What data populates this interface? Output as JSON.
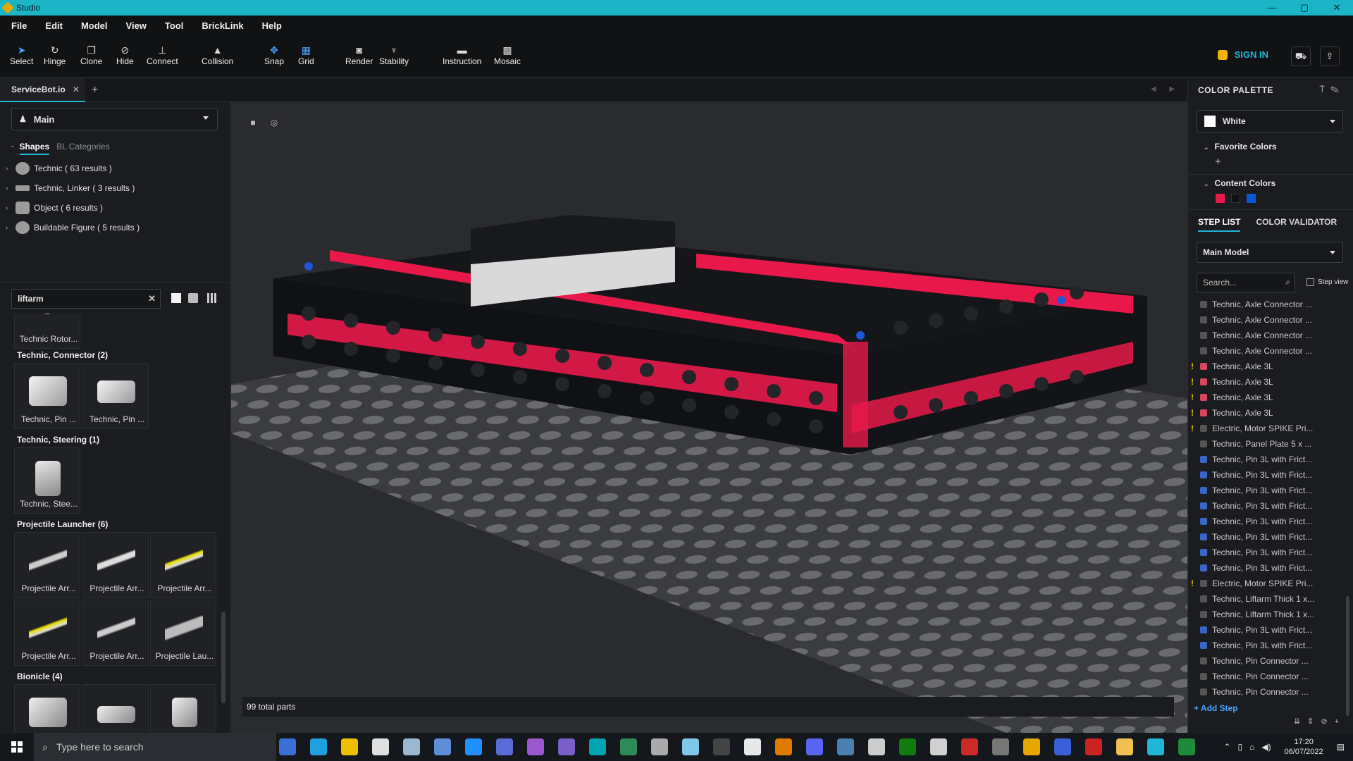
{
  "window": {
    "title": "Studio",
    "controls": [
      "—",
      "▢",
      "✕"
    ]
  },
  "menu": [
    "File",
    "Edit",
    "Model",
    "View",
    "Tool",
    "BrickLink",
    "Help"
  ],
  "toolbar": {
    "tools": [
      {
        "label": "Select",
        "icon": "cursor-icon",
        "glyph": "➤"
      },
      {
        "label": "Hinge",
        "icon": "hinge-icon",
        "glyph": "↻"
      },
      {
        "label": "Clone",
        "icon": "clone-icon",
        "glyph": "❐"
      },
      {
        "label": "Hide",
        "icon": "hide-icon",
        "glyph": "⊘"
      },
      {
        "label": "Connect",
        "icon": "connect-icon",
        "glyph": "⊥"
      },
      {
        "label": "Collision",
        "icon": "collision-icon",
        "glyph": "▲"
      },
      {
        "label": "Snap",
        "icon": "snap-icon",
        "glyph": "✥"
      },
      {
        "label": "Grid",
        "icon": "grid-icon",
        "glyph": "▦"
      },
      {
        "label": "Render",
        "icon": "camera-icon",
        "glyph": "◙"
      },
      {
        "label": "Stability",
        "icon": "stability-icon",
        "glyph": "♆"
      },
      {
        "label": "Instruction",
        "icon": "instruction-icon",
        "glyph": "▬"
      },
      {
        "label": "Mosaic",
        "icon": "mosaic-icon",
        "glyph": "▩"
      }
    ],
    "signin": "SIGN IN"
  },
  "tabs": {
    "active": "ServiceBot.io",
    "close": "✕",
    "add": "+",
    "nav": "◀ ▶"
  },
  "left": {
    "model_dropdown": "Main",
    "subtabs": [
      "Shapes",
      "BL Categories"
    ],
    "shapes": [
      {
        "label": "Technic ( 63 results )"
      },
      {
        "label": "Technic, Linker ( 3 results )"
      },
      {
        "label": "Object ( 6 results )"
      },
      {
        "label": "Buildable Figure ( 5 results )"
      }
    ],
    "search_value": "liftarm",
    "search_clear": "✕",
    "top_partial_label": "Technic Rotor...",
    "categories": [
      {
        "title": "Technic, Connector (2)",
        "parts": [
          "Technic, Pin ...",
          "Technic, Pin ..."
        ]
      },
      {
        "title": "Technic, Steering (1)",
        "parts": [
          "Technic, Stee..."
        ]
      },
      {
        "title": "Projectile Launcher (6)",
        "parts": [
          "Projectile Arr...",
          "Projectile Arr...",
          "Projectile Arr...",
          "Projectile Arr...",
          "Projectile Arr...",
          "Projectile Lau..."
        ]
      },
      {
        "title": "Bionicle (4)",
        "parts": [
          "",
          "",
          ""
        ]
      }
    ]
  },
  "viewport": {
    "total_parts": "99 total parts"
  },
  "right": {
    "color_palette_title": "COLOR PALETTE",
    "selected_color": "White",
    "favorite_colors": "Favorite Colors",
    "add_favorite": "+",
    "content_colors": "Content Colors",
    "content_swatches": [
      "#e8194a",
      "#0f1215",
      "#0a57d4"
    ],
    "step_tabs": [
      "STEP LIST",
      "COLOR VALIDATOR"
    ],
    "model": "Main Model",
    "search_placeholder": "Search...",
    "step_view": "Step view",
    "steps": [
      {
        "t": "Technic, Axle Connector ...",
        "w": false,
        "c": "#555"
      },
      {
        "t": "Technic, Axle Connector ...",
        "w": false,
        "c": "#555"
      },
      {
        "t": "Technic, Axle Connector ...",
        "w": false,
        "c": "#555"
      },
      {
        "t": "Technic, Axle Connector ...",
        "w": false,
        "c": "#555"
      },
      {
        "t": "Technic, Axle  3L",
        "w": true,
        "c": "#d8475f"
      },
      {
        "t": "Technic, Axle  3L",
        "w": true,
        "c": "#d8475f"
      },
      {
        "t": "Technic, Axle  3L",
        "w": true,
        "c": "#d8475f"
      },
      {
        "t": "Technic, Axle  3L",
        "w": true,
        "c": "#d8475f"
      },
      {
        "t": "Electric, Motor SPIKE Pri...",
        "w": true,
        "c": "#555"
      },
      {
        "t": "Technic, Panel Plate 5 x ...",
        "w": false,
        "c": "#555"
      },
      {
        "t": "Technic, Pin 3L with Frict...",
        "w": false,
        "c": "#3a64c8"
      },
      {
        "t": "Technic, Pin 3L with Frict...",
        "w": false,
        "c": "#3a64c8"
      },
      {
        "t": "Technic, Pin 3L with Frict...",
        "w": false,
        "c": "#3a64c8"
      },
      {
        "t": "Technic, Pin 3L with Frict...",
        "w": false,
        "c": "#3a64c8"
      },
      {
        "t": "Technic, Pin 3L with Frict...",
        "w": false,
        "c": "#3a64c8"
      },
      {
        "t": "Technic, Pin 3L with Frict...",
        "w": false,
        "c": "#3a64c8"
      },
      {
        "t": "Technic, Pin 3L with Frict...",
        "w": false,
        "c": "#3a64c8"
      },
      {
        "t": "Technic, Pin 3L with Frict...",
        "w": false,
        "c": "#3a64c8"
      },
      {
        "t": "Electric, Motor SPIKE Pri...",
        "w": true,
        "c": "#555"
      },
      {
        "t": "Technic, Liftarm Thick 1 x...",
        "w": false,
        "c": "#555"
      },
      {
        "t": "Technic, Liftarm Thick 1 x...",
        "w": false,
        "c": "#555"
      },
      {
        "t": "Technic, Pin 3L with Frict...",
        "w": false,
        "c": "#3a64c8"
      },
      {
        "t": "Technic, Pin 3L with Frict...",
        "w": false,
        "c": "#3a64c8"
      },
      {
        "t": "Technic, Pin Connector ...",
        "w": false,
        "c": "#555"
      },
      {
        "t": "Technic, Pin Connector ...",
        "w": false,
        "c": "#555"
      },
      {
        "t": "Technic, Pin Connector ...",
        "w": false,
        "c": "#555"
      }
    ],
    "add_step": "+ Add Step"
  },
  "taskbar": {
    "search_placeholder": "Type here to search",
    "time": "17:20",
    "date": "06/07/2022",
    "apps": [
      "#3a6fd8",
      "#1fa0e0",
      "#f0c000",
      "#e0e0e0",
      "#9bb8d0",
      "#5f8ed8",
      "#1e90ff",
      "#5a6bd8",
      "#9b59d0",
      "#7a5fc8",
      "#00a3b0",
      "#2e8b57",
      "#aaa",
      "#7fc8e8",
      "#444",
      "#e8e8e8",
      "#e07b00",
      "#5865f2",
      "#4a7fb0",
      "#ccc",
      "#107c10",
      "#d0d0d0",
      "#cc2a2a",
      "#777",
      "#e8a600",
      "#3a5fd8",
      "#c22",
      "#f0c050",
      "#1fb6d8",
      "#1f8a3a"
    ]
  }
}
